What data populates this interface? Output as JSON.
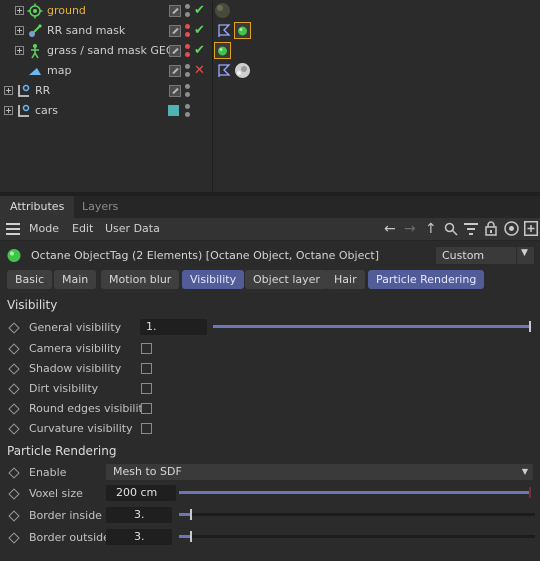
{
  "objects": [
    {
      "name": "ground",
      "status": "✔",
      "tag_icon": "ground-sphere-icon"
    },
    {
      "name": "RR sand mask",
      "status": "✔",
      "tag_icon": "octane-tag-icon"
    },
    {
      "name": "grass / sand mask GEO",
      "status": "✔",
      "tag_icon": "octane-tag-icon"
    },
    {
      "name": "map",
      "status": "✕",
      "tag_icon": "texture-tag-icon"
    },
    {
      "name": "RR",
      "status": "",
      "tag_icon": ""
    },
    {
      "name": "cars",
      "status": "",
      "tag_icon": ""
    }
  ],
  "manager_tabs": {
    "attributes": "Attributes",
    "layers": "Layers"
  },
  "menu": {
    "mode": "Mode",
    "edit": "Edit",
    "user_data": "User Data"
  },
  "object_title": "Octane ObjectTag (2 Elements) [Octane Object, Octane Object]",
  "preset_select": "Custom",
  "tabs": [
    "Basic",
    "Main",
    "Motion blur",
    "Visibility",
    "Object layer",
    "Hair",
    "Particle Rendering"
  ],
  "visibility": {
    "heading": "Visibility",
    "general_label": "General visibility",
    "general_value": "1.",
    "general_level": 1.0,
    "camera_label": "Camera visibility",
    "shadow_label": "Shadow visibility",
    "dirt_label": "Dirt visibility",
    "round_edges_label": "Round edges visibility",
    "curvature_label": "Curvature visibility"
  },
  "particle": {
    "heading": "Particle Rendering",
    "enable_label": "Enable",
    "enable_value": "Mesh to SDF",
    "voxel_label": "Voxel size",
    "voxel_value": "200 cm",
    "voxel_level": 1.0,
    "border_inside_label": "Border inside",
    "border_inside_value": "3.",
    "border_inside_level": 0.03,
    "border_outside_label": "Border outside",
    "border_outside_value": "3.",
    "border_outside_level": 0.03
  },
  "colors": {
    "active_tab": "#515c98",
    "slider_fill": "#6b77b8",
    "ground_label": "#e8b33a",
    "check_green": "#5fd35f",
    "cross_red": "#e05050",
    "selected_tag_border": "#e0a020",
    "cars_swatch": "#4fb3b3"
  }
}
